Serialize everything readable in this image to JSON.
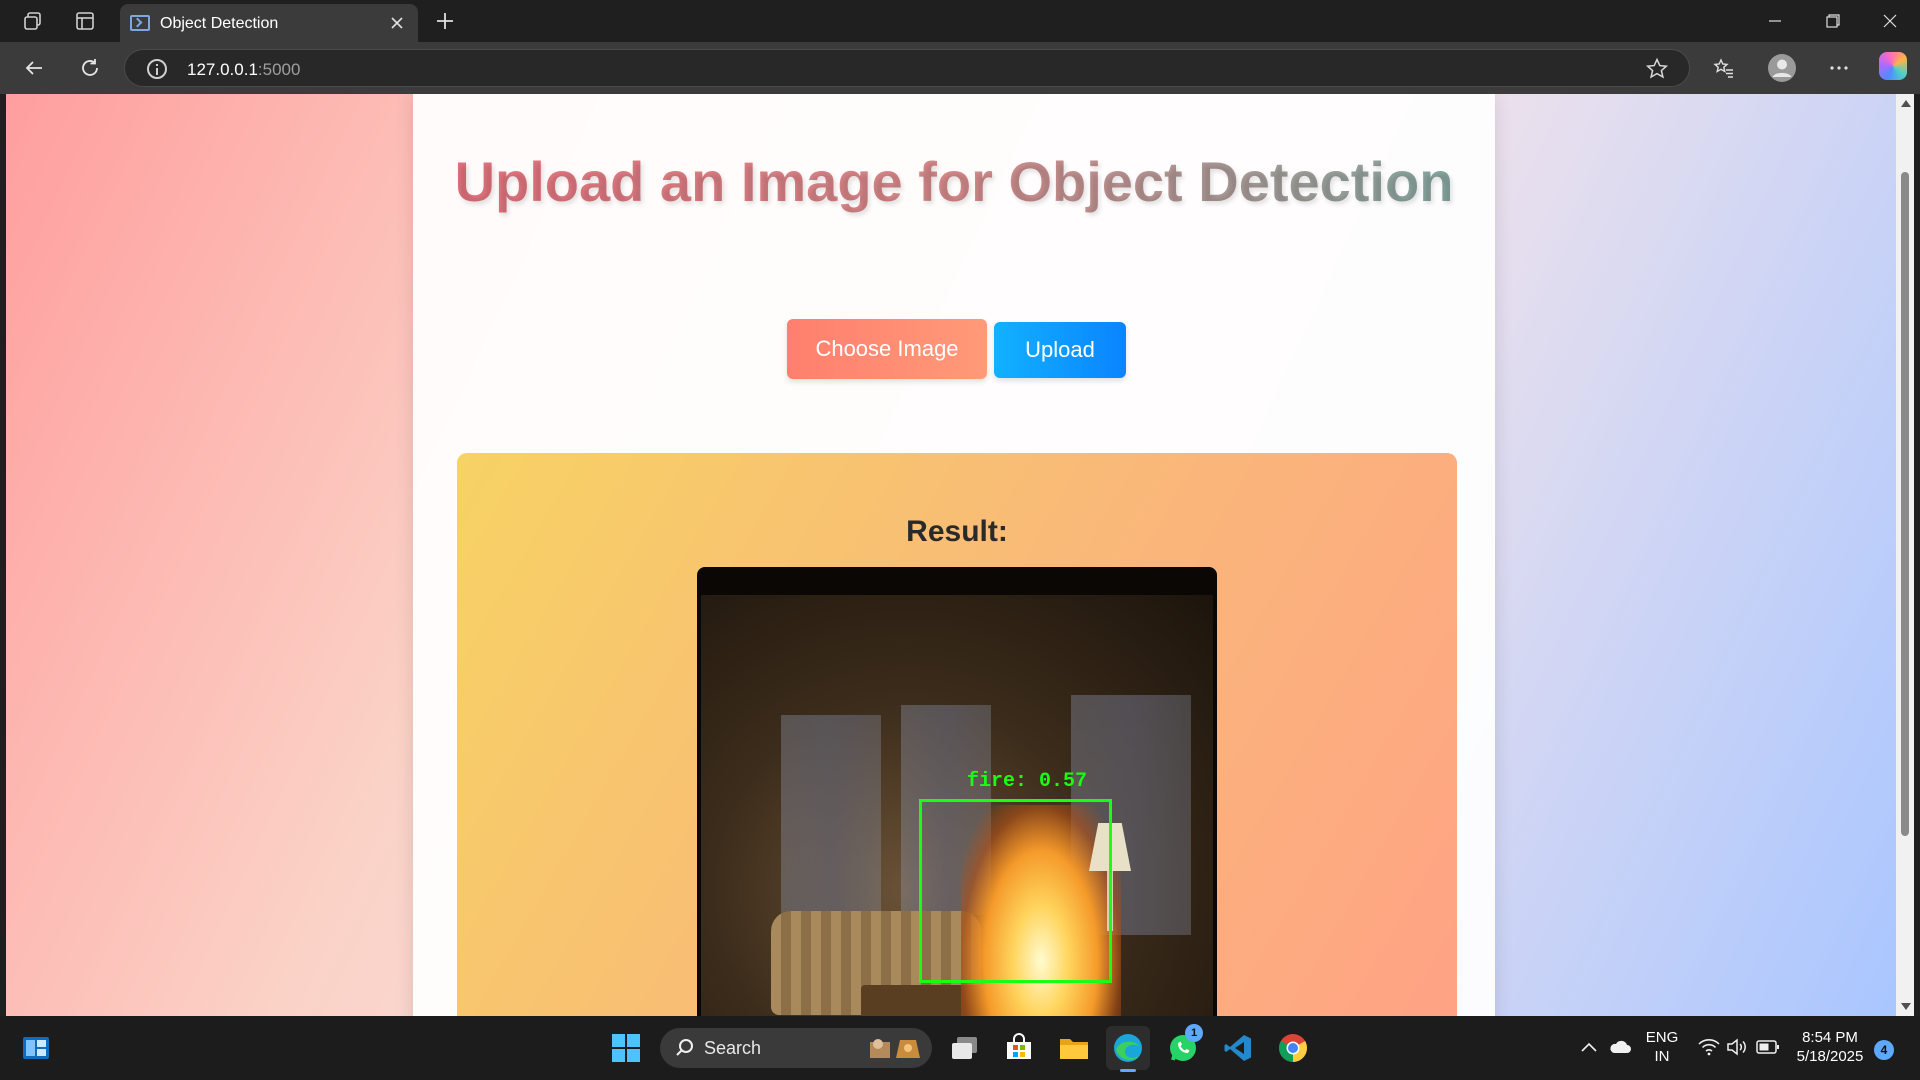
{
  "browser": {
    "tab_title": "Object Detection",
    "url_host": "127.0.0.1",
    "url_port": ":5000"
  },
  "page": {
    "heading": "Upload an Image for Object Detection",
    "choose_button": "Choose Image",
    "upload_button": "Upload",
    "result_title": "Result:",
    "detection": {
      "label": "fire: 0.57",
      "class": "fire",
      "confidence": 0.57,
      "box_color": "#18ff14"
    }
  },
  "taskbar": {
    "search_label": "Search",
    "language_line1": "ENG",
    "language_line2": "IN",
    "time": "8:54 PM",
    "date": "5/18/2025",
    "notification_count": "4",
    "whatsapp_badge": "1",
    "apps": [
      "start-icon",
      "search-icon",
      "task-view-icon",
      "store-icon",
      "file-explorer-icon",
      "edge-icon",
      "whatsapp-icon",
      "vscode-icon",
      "chrome-icon"
    ]
  },
  "colors": {
    "choose_button": "#ff8a72",
    "upload_button": "#0a9cff",
    "result_box_start": "#f7d264",
    "result_box_end": "#ffa285"
  }
}
